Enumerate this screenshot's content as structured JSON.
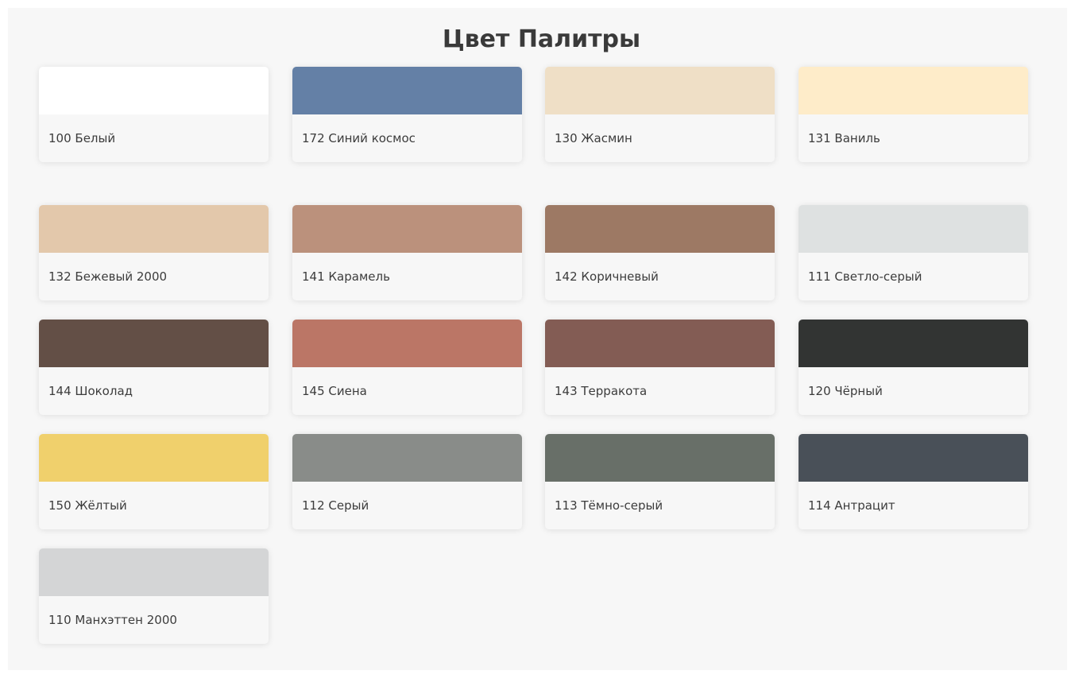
{
  "page": {
    "title": "Цвет Палитры"
  },
  "palette": [
    {
      "label": "100 Белый",
      "color": "#ffffff"
    },
    {
      "label": "172 Синий космос",
      "color": "#6480a6"
    },
    {
      "label": "130 Жасмин",
      "color": "#efdfc6"
    },
    {
      "label": "131 Ваниль",
      "color": "#feecc9"
    },
    {
      "label": "132 Бежевый 2000",
      "color": "#e3c8ab"
    },
    {
      "label": "141 Карамель",
      "color": "#bb917c"
    },
    {
      "label": "142 Коричневый",
      "color": "#9d7964"
    },
    {
      "label": "111 Светло-серый",
      "color": "#dee1e1"
    },
    {
      "label": "144 Шоколад",
      "color": "#634f46"
    },
    {
      "label": "145 Сиена",
      "color": "#bb7666"
    },
    {
      "label": "143 Терракота",
      "color": "#835c54"
    },
    {
      "label": "120 Чёрный",
      "color": "#323433"
    },
    {
      "label": "150 Жёлтый",
      "color": "#f0d06c"
    },
    {
      "label": "112 Серый",
      "color": "#898c89"
    },
    {
      "label": "113 Тёмно-серый",
      "color": "#686f68"
    },
    {
      "label": "114 Антрацит",
      "color": "#495058"
    },
    {
      "label": "110 Манхэттен 2000",
      "color": "#d4d5d6"
    }
  ]
}
